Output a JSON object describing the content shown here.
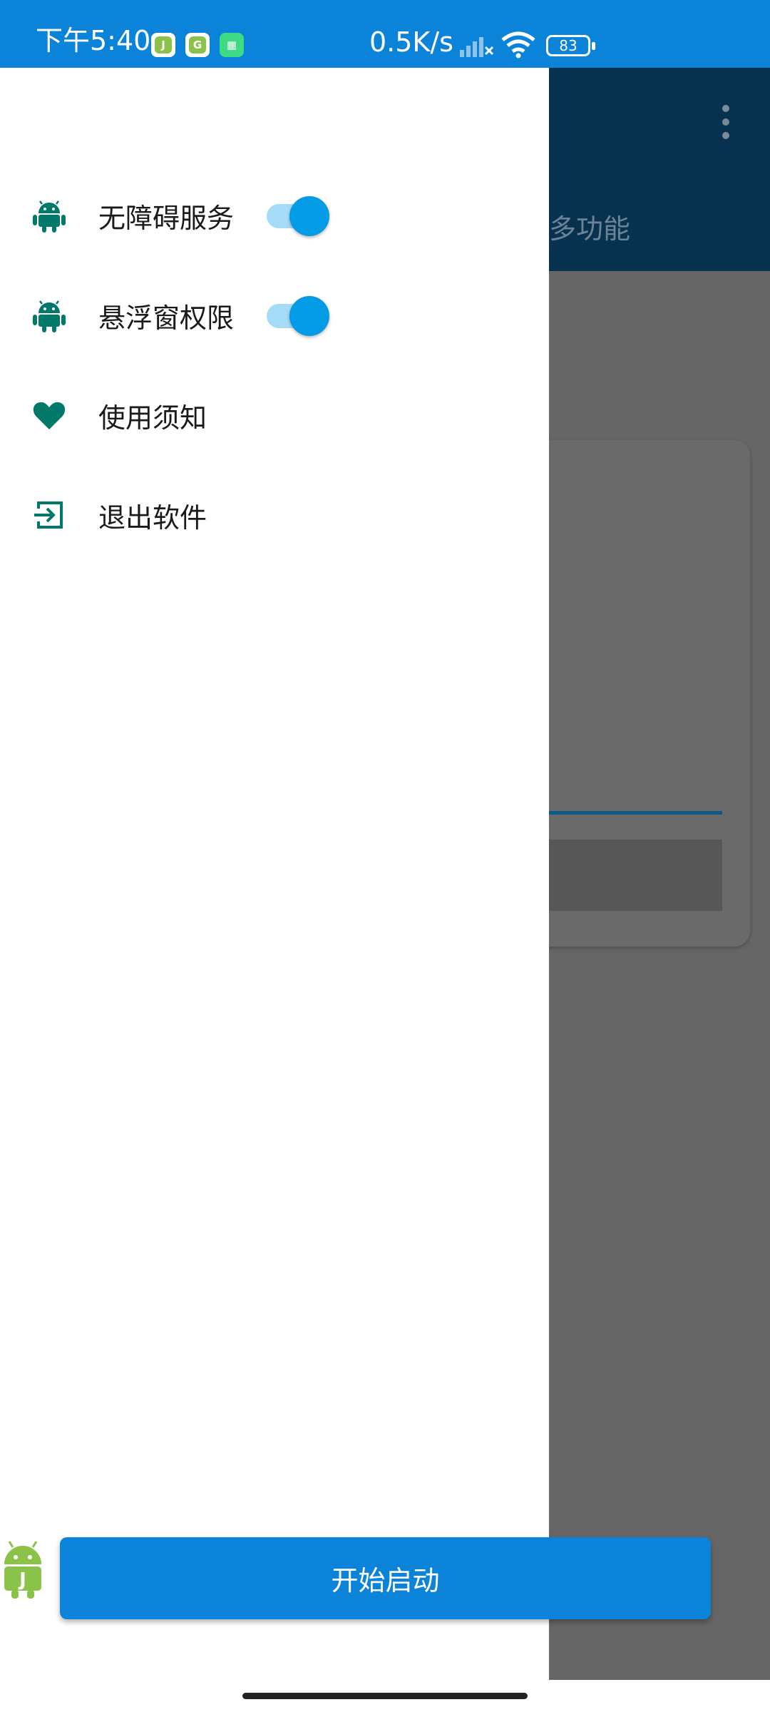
{
  "status_bar": {
    "time": "下午5:40",
    "net_speed": "0.5K/s",
    "battery": "83",
    "notification_icons": [
      "app-j-icon",
      "app-g-icon",
      "android-grid-icon"
    ]
  },
  "background_app": {
    "tab_label": "多功能"
  },
  "drawer": {
    "items": [
      {
        "label": "无障碍服务",
        "icon": "android-icon",
        "toggle": true,
        "toggle_on": true
      },
      {
        "label": "悬浮窗权限",
        "icon": "android-icon",
        "toggle": true,
        "toggle_on": true
      },
      {
        "label": "使用须知",
        "icon": "heart-icon",
        "toggle": false
      },
      {
        "label": "退出软件",
        "icon": "exit-icon",
        "toggle": false
      }
    ]
  },
  "start_button": {
    "label": "开始启动"
  },
  "colors": {
    "accent": "#0b83d9",
    "icon_green": "#00796b",
    "switch_thumb": "#039be5",
    "switch_track": "#a6dbf7"
  }
}
